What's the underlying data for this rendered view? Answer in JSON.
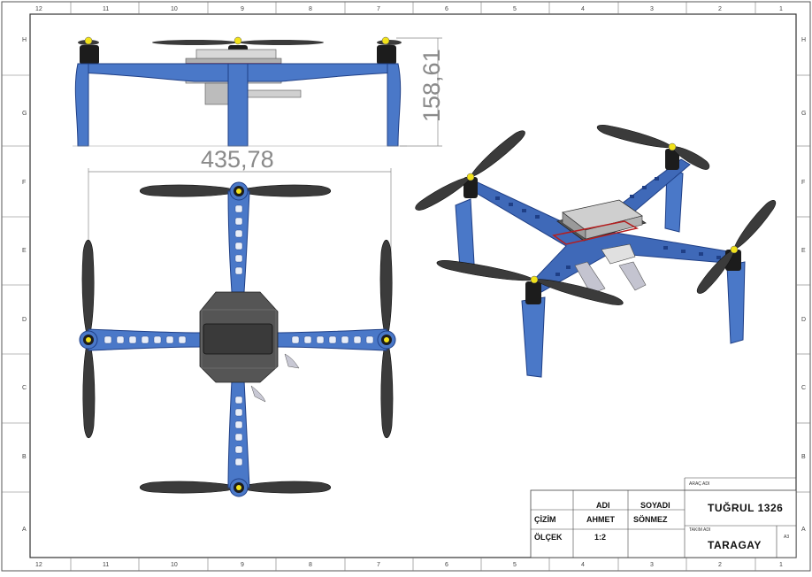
{
  "sheet": {
    "col_labels": [
      "12",
      "11",
      "10",
      "9",
      "8",
      "7",
      "6",
      "5",
      "4",
      "3",
      "2",
      "1"
    ],
    "row_labels": [
      "H",
      "G",
      "F",
      "E",
      "D",
      "C",
      "B",
      "A"
    ]
  },
  "dimensions": {
    "height": "158,61",
    "width": "435,78"
  },
  "title_block": {
    "col_ad": "ADI",
    "col_soyad": "SOYADI",
    "row_cizim": "ÇİZİM",
    "cizim_ad": "AHMET",
    "cizim_soyad": "SÖNMEZ",
    "row_olcek": "ÖLÇEK",
    "olcek_value": "1:2",
    "arac_label": "ARAÇ ADI",
    "arac_value": "TUĞRUL 1326",
    "takim_label": "TAKIM ADI",
    "takim_value": "TARAGAY",
    "sheet_size": "A3"
  },
  "colors": {
    "frame_blue": "#4a78c8",
    "frame_blue_dark": "#1f3f86",
    "propeller": "#3a3a3a",
    "motor": "#1c1c1c",
    "hub": "#f2e21a"
  }
}
